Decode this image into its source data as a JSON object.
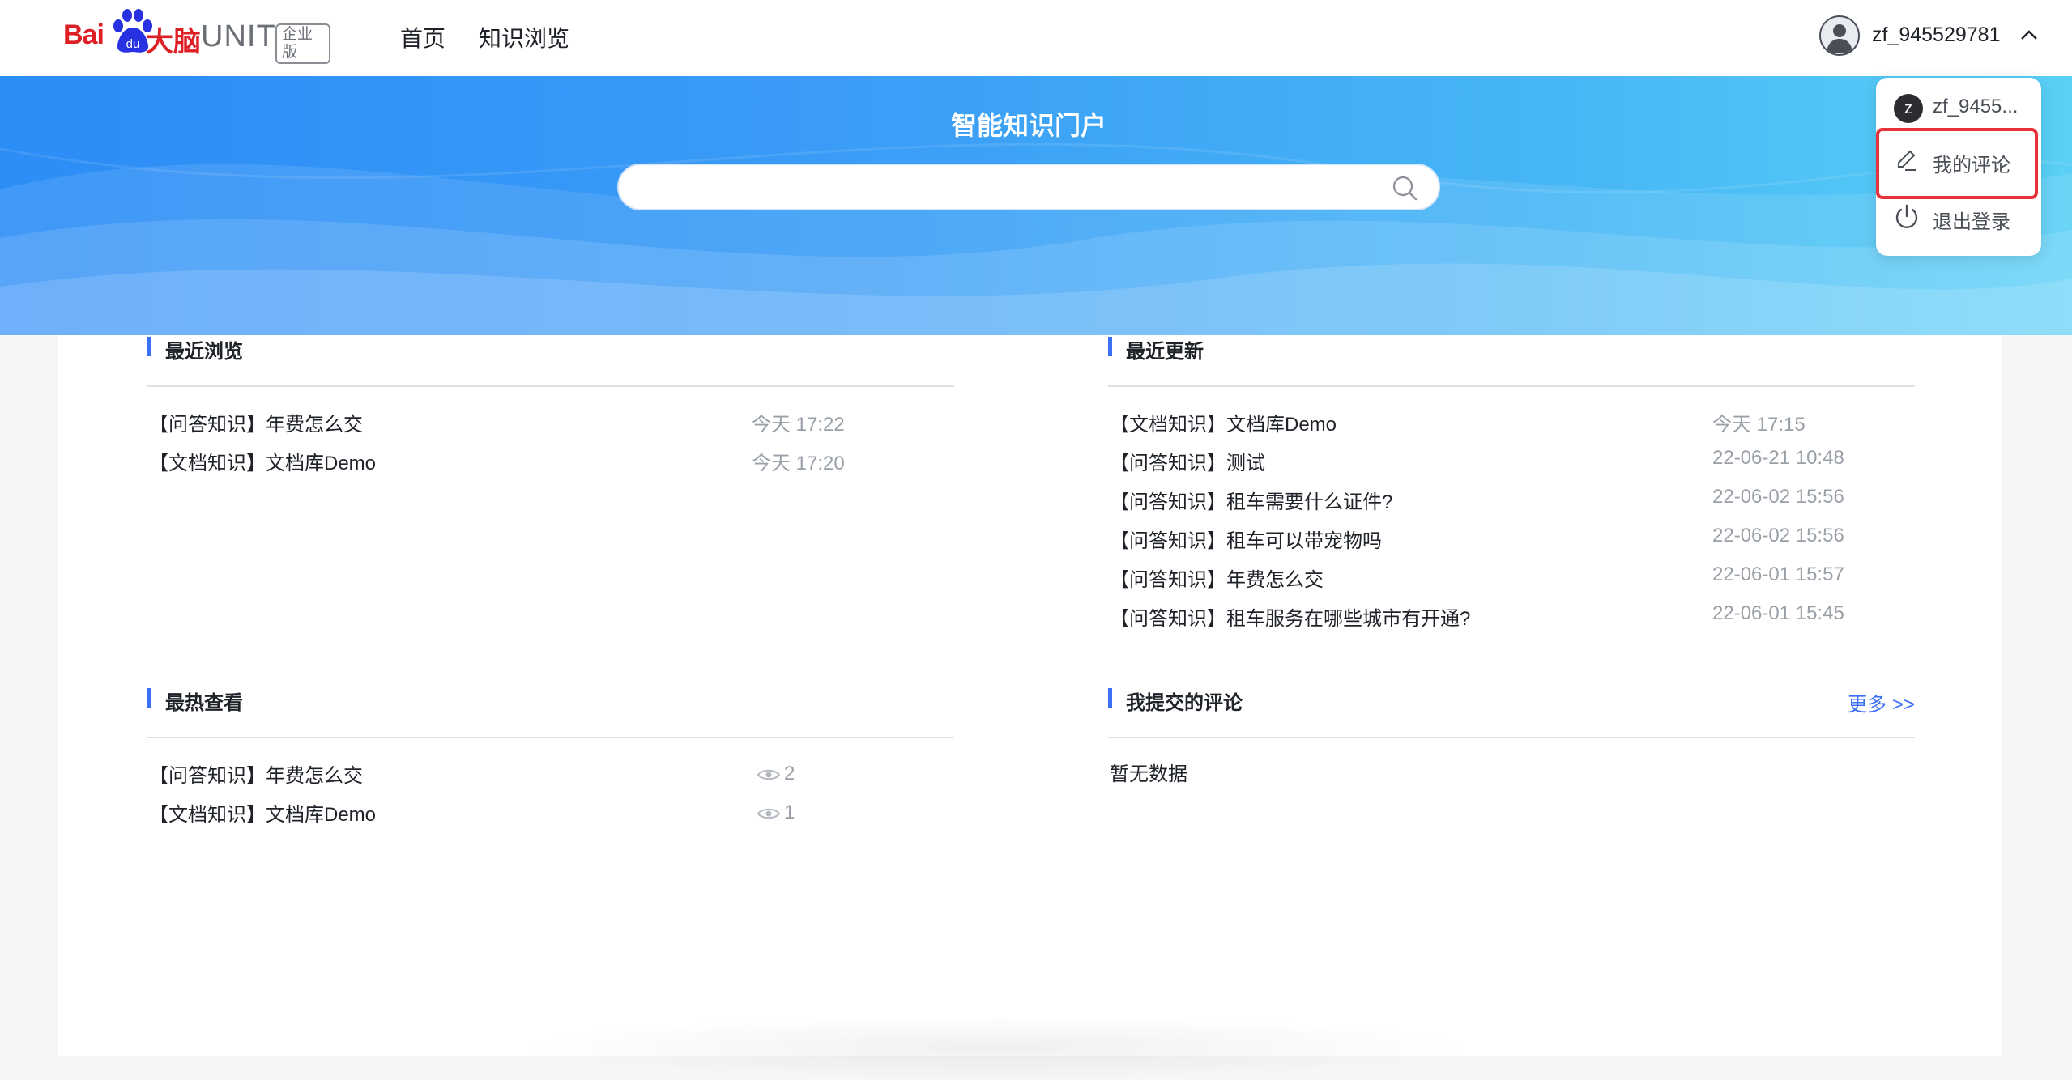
{
  "header": {
    "logo": {
      "bai": "Bai",
      "du": "du",
      "dana": "大脑",
      "unit": "UNIT",
      "edition": "企业版"
    },
    "nav": [
      {
        "label": "首页"
      },
      {
        "label": "知识浏览"
      }
    ],
    "user": {
      "name": "zf_945529781"
    }
  },
  "banner": {
    "title": "智能知识门户",
    "search_value": "",
    "search_placeholder": ""
  },
  "sections": {
    "recent": {
      "title": "最近浏览",
      "items": [
        {
          "title": "【问答知识】年费怎么交",
          "time": "今天 17:22"
        },
        {
          "title": "【文档知识】文档库Demo",
          "time": "今天 17:20"
        }
      ]
    },
    "updated": {
      "title": "最近更新",
      "items": [
        {
          "title": "【文档知识】文档库Demo",
          "time": "今天 17:15"
        },
        {
          "title": "【问答知识】测试",
          "time": "22-06-21 10:48"
        },
        {
          "title": "【问答知识】租车需要什么证件?",
          "time": "22-06-02 15:56"
        },
        {
          "title": "【问答知识】租车可以带宠物吗",
          "time": "22-06-02 15:56"
        },
        {
          "title": "【问答知识】年费怎么交",
          "time": "22-06-01 15:57"
        },
        {
          "title": "【问答知识】租车服务在哪些城市有开通?",
          "time": "22-06-01 15:45"
        }
      ]
    },
    "hot": {
      "title": "最热查看",
      "items": [
        {
          "title": "【问答知识】年费怎么交",
          "views": "2"
        },
        {
          "title": "【文档知识】文档库Demo",
          "views": "1"
        }
      ]
    },
    "comments": {
      "title": "我提交的评论",
      "more": "更多 >>",
      "empty": "暂无数据"
    }
  },
  "dropdown": {
    "avatar_letter": "z",
    "user_short": "zf_9455...",
    "my_comments": "我的评论",
    "logout": "退出登录"
  },
  "colors": {
    "accent": "#3b6ff6",
    "brand_red": "#de1f26",
    "highlight": "#e6323a",
    "banner_start": "#2b8df6",
    "banner_end": "#5ad0f6"
  },
  "icons": [
    "baidu-paw-icon",
    "search-icon",
    "chevron-up-icon",
    "user-avatar-icon",
    "edit-icon",
    "power-icon",
    "eye-icon"
  ]
}
